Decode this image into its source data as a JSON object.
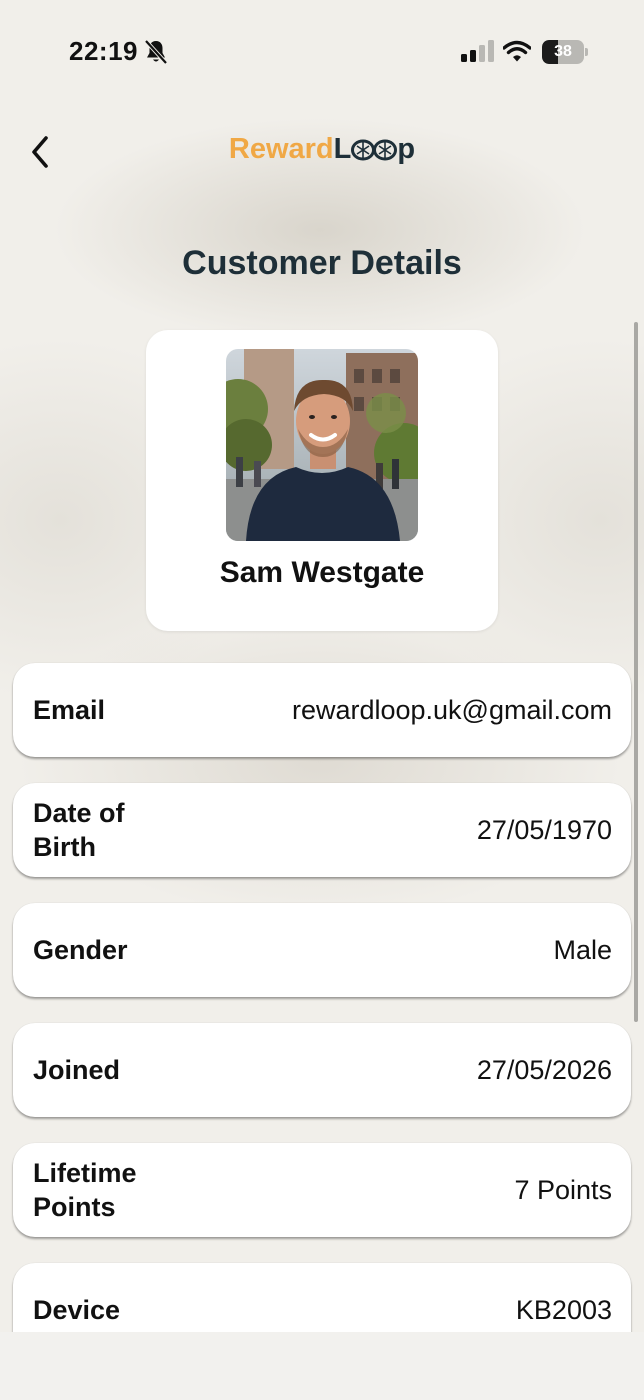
{
  "status_bar": {
    "time": "22:19",
    "battery_level": "38",
    "battery_fraction": 0.38,
    "icons": [
      "bell-slash-icon",
      "cellular-signal-icon",
      "wifi-icon",
      "battery-icon"
    ]
  },
  "header": {
    "back_icon": "chevron-left-icon",
    "logo_part1": "Reward",
    "logo_part2_a": "L",
    "logo_part2_b": "p"
  },
  "page": {
    "title": "Customer Details"
  },
  "profile": {
    "name": "Sam Westgate",
    "avatar": "profile-photo"
  },
  "details": [
    {
      "label": "Email",
      "value": "rewardloop.uk@gmail.com"
    },
    {
      "label": "Date of Birth",
      "value": "27/05/1970"
    },
    {
      "label": "Gender",
      "value": "Male"
    },
    {
      "label": "Joined",
      "value": "27/05/2026"
    },
    {
      "label": "Lifetime Points",
      "value": "7 Points"
    },
    {
      "label": "Device",
      "value": "KB2003"
    }
  ],
  "colors": {
    "brand_orange": "#f0a845",
    "brand_dark": "#1e2f38",
    "card": "#ffffff",
    "background": "#f1efea"
  }
}
